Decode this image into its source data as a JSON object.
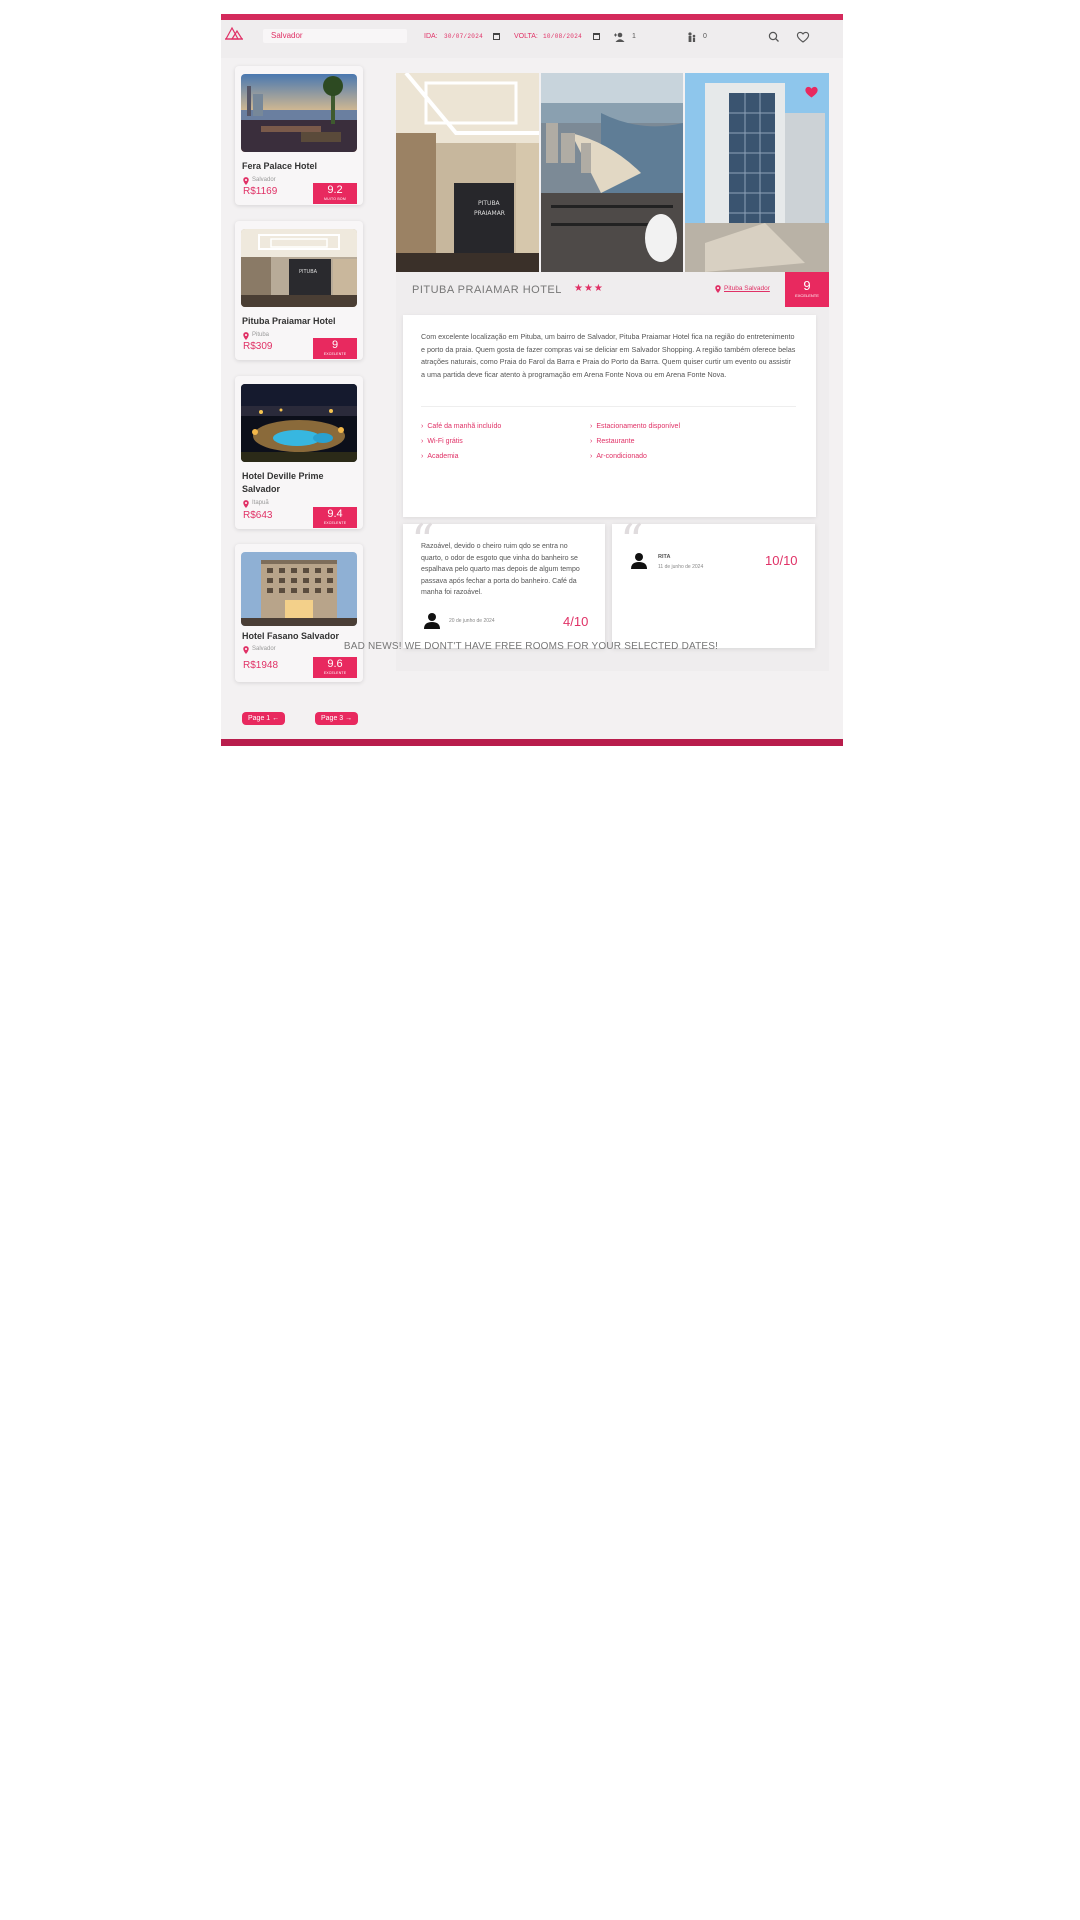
{
  "header": {
    "search_value": "Salvador",
    "ida_label": "IDA:",
    "ida_date": "30/07/2024",
    "volta_label": "VOLTA:",
    "volta_date": "10/08/2024",
    "adults_count": "1",
    "children_count": "0"
  },
  "sidebar": {
    "hotels": [
      {
        "name": "Fera Palace Hotel",
        "location": "Salvador",
        "price": "R$1169",
        "score": "9.2",
        "score_sub": "MUITO BOM"
      },
      {
        "name": "Pituba Praiamar Hotel",
        "location": "Pituba",
        "price": "R$309",
        "score": "9",
        "score_sub": "EXCELENTE"
      },
      {
        "name": "Hotel Deville Prime Salvador",
        "location": "Itapuã",
        "price": "R$643",
        "score": "9.4",
        "score_sub": "EXCELENTE"
      },
      {
        "name": "Hotel Fasano Salvador",
        "location": "Salvador",
        "price": "R$1948",
        "score": "9.6",
        "score_sub": "EXCELENTE"
      }
    ],
    "prev_page": "Page 1",
    "next_page": "Page 3"
  },
  "main": {
    "hotel_name": "PITUBA PRAIAMAR HOTEL",
    "stars": "★★★",
    "location_link": "Pituba Salvador",
    "score": "9",
    "score_sub": "EXCELENTE",
    "description": "Com excelente localização em Pituba, um bairro de Salvador, Pituba Praiamar Hotel fica na região do entretenimento e porto da praia. Quem gosta de fazer compras vai se deliciar em Salvador Shopping. A região também oferece belas atrações naturais, como Praia do Farol da Barra e Praia do Porto da Barra. Quem quiser curtir um evento ou assistir a uma partida deve ficar atento à programação em Arena Fonte Nova ou em Arena Fonte Nova.",
    "amenities_left": [
      "Café da manhã incluído",
      "Wi-Fi grátis",
      "Academia"
    ],
    "amenities_right": [
      "Estacionamento disponível",
      "Restaurante",
      "Ar-condicionado"
    ]
  },
  "reviews": [
    {
      "text": "Razoável, devido o cheiro ruim qdo se entra no quarto, o odor de esgoto que vinha do banheiro se espalhava pelo quarto mas depois de algum tempo passava após fechar a porta do banheiro. Café da manha foi razoável.",
      "date": "20 de junho de 2024",
      "score": "4/10"
    },
    {
      "name": "RITA",
      "date": "11 de junho de 2024",
      "score": "10/10"
    }
  ],
  "bad_news": "BAD NEWS! WE DONT'T HAVE FREE ROOMS FOR YOUR SELECTED DATES!",
  "colors": {
    "accent": "#e8295f",
    "bar": "#d42a5c"
  }
}
